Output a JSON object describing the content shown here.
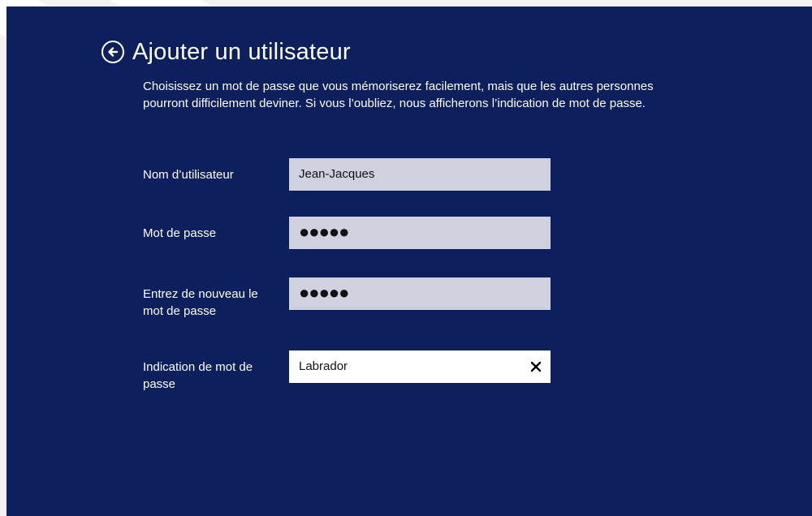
{
  "header": {
    "title": "Ajouter un utilisateur",
    "back_icon": "back-arrow-circle-icon"
  },
  "description": {
    "line1": "Choisissez un mot de passe que vous mémoriserez facilement, mais que les autres personnes",
    "line2": "pourront difficilement deviner. Si vous l’oubliez, nous afficherons l’indication de mot de passe."
  },
  "form": {
    "username": {
      "label": "Nom d’utilisateur",
      "value": "Jean-Jacques"
    },
    "password": {
      "label": "Mot de passe",
      "value": "●●●●●"
    },
    "password_confirm": {
      "label_line1": "Entrez de nouveau le",
      "label_line2": "mot de passe",
      "value": "●●●●●"
    },
    "hint": {
      "label_line1": "Indication de mot de",
      "label_line2": "passe",
      "value": "Labrador",
      "clear_icon": "close-icon"
    }
  },
  "colors": {
    "background": "#0d1f5c",
    "field_inactive": "#cfd2de",
    "field_active": "#ffffff",
    "text": "#ffffff"
  }
}
